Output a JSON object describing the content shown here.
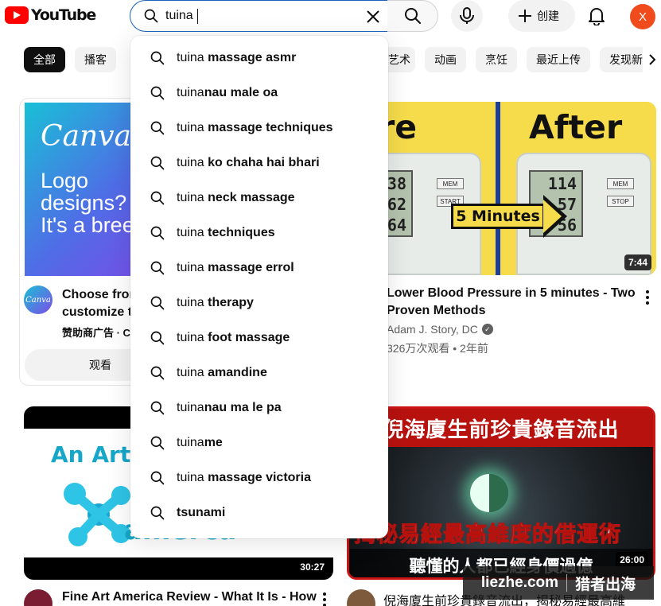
{
  "header": {
    "logo_text": "YouTube",
    "search_value": "tuina",
    "create_label": "创建",
    "avatar_letter": "X"
  },
  "chips": [
    "全部",
    "播客",
    "艺术",
    "动画",
    "烹饪",
    "最近上传",
    "发现新"
  ],
  "search_suggestions": [
    {
      "typed": "tuina",
      "rest": " massage asmr"
    },
    {
      "typed": "tuina",
      "rest": "nau male oa"
    },
    {
      "typed": "tuina",
      "rest": " massage techniques"
    },
    {
      "typed": "tuina",
      "rest": " ko chaha hai bhari"
    },
    {
      "typed": "tuina",
      "rest": " neck massage"
    },
    {
      "typed": "tuina",
      "rest": " techniques"
    },
    {
      "typed": "tuina",
      "rest": " massage errol"
    },
    {
      "typed": "tuina",
      "rest": " therapy"
    },
    {
      "typed": "tuina",
      "rest": " foot massage"
    },
    {
      "typed": "tuina",
      "rest": " amandine"
    },
    {
      "typed": "tuina",
      "rest": "nau ma le pa"
    },
    {
      "typed": "tuina",
      "rest": "me"
    },
    {
      "typed": "tuina",
      "rest": " massage victoria"
    },
    {
      "typed": "",
      "rest": "tsunami"
    }
  ],
  "ad": {
    "brand": "Canva",
    "headline": "Logo\ndesigns?\nIt's a bree",
    "logo_text": "Canva",
    "title": "Choose from\ncustomize to",
    "sponsor": "赞助商广告 · C",
    "button_label": "观看"
  },
  "videos": [
    {
      "title": "Lower Blood Pressure in 5 minutes - Two\nProven Methods",
      "channel": "Adam J. Story, DC",
      "meta": "326万次观看 • 2年前",
      "duration": "7:44",
      "thumb_before": "Before",
      "thumb_after": "After",
      "thumb_callout": "5 Minutes",
      "reading_before": [
        "138",
        "62",
        "64"
      ],
      "reading_after": [
        "114",
        "57",
        "56"
      ],
      "key_mem": "MEM",
      "key_start": "START",
      "key_stop": "STOP"
    },
    {
      "title": "Fine Art America Review - What It Is - How",
      "duration": "30:27",
      "thumb_line1": "An Art",
      "thumb_line2": "amerca"
    },
    {
      "title": "倪海廈生前珍貴錄音流出，揭秘易經最高維",
      "duration": "26:00",
      "thumb_top": "倪海廈生前珍貴錄音流出",
      "thumb_mid": "揭秘易經最高維度的借運術",
      "thumb_bottom": "聽懂的人都已經身價過億"
    }
  ],
  "watermark": {
    "left": "liezhe.com",
    "right": "猎者出海"
  }
}
